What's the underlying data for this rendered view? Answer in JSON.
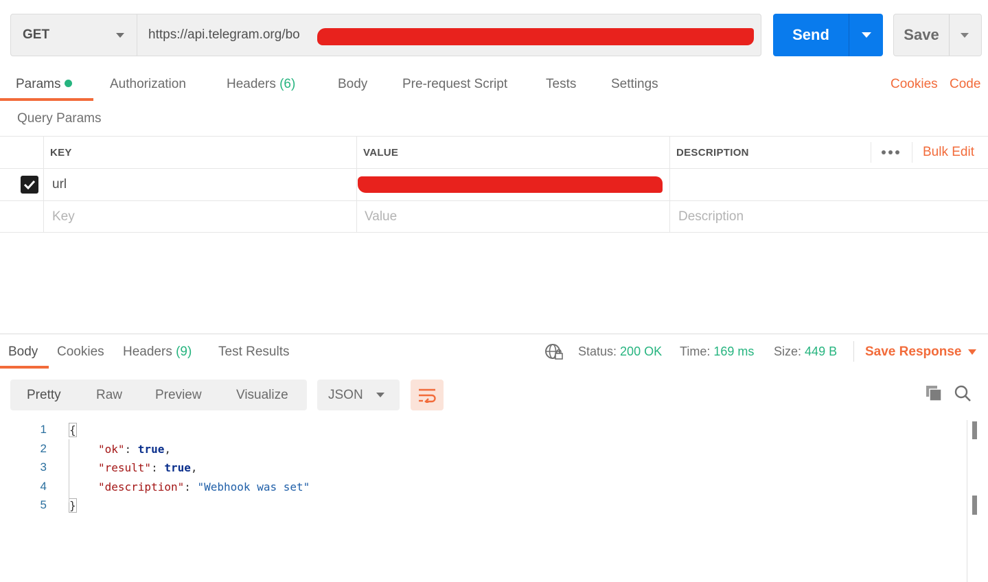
{
  "request": {
    "method": "GET",
    "url": "https://api.telegram.org/bo",
    "send_label": "Send",
    "save_label": "Save"
  },
  "request_tabs": {
    "params": "Params",
    "authorization": "Authorization",
    "headers": "Headers",
    "headers_count": "(6)",
    "body": "Body",
    "prerequest": "Pre-request Script",
    "tests": "Tests",
    "settings": "Settings",
    "cookies": "Cookies",
    "code": "Code"
  },
  "query_params": {
    "title": "Query Params",
    "headers": {
      "key": "KEY",
      "value": "VALUE",
      "description": "DESCRIPTION",
      "bulk_edit": "Bulk Edit"
    },
    "rows": [
      {
        "checked": true,
        "key": "url",
        "value": "",
        "description": ""
      }
    ],
    "placeholders": {
      "key": "Key",
      "value": "Value",
      "description": "Description"
    }
  },
  "response": {
    "tabs": {
      "body": "Body",
      "cookies": "Cookies",
      "headers": "Headers",
      "headers_count": "(9)",
      "test_results": "Test Results"
    },
    "status_label": "Status:",
    "status_value": "200 OK",
    "time_label": "Time:",
    "time_value": "169 ms",
    "size_label": "Size:",
    "size_value": "449 B",
    "save_response": "Save Response",
    "view_modes": {
      "pretty": "Pretty",
      "raw": "Raw",
      "preview": "Preview",
      "visualize": "Visualize"
    },
    "format": "JSON",
    "code_lines": [
      {
        "n": "1",
        "open": "{"
      },
      {
        "n": "2",
        "key": "\"ok\"",
        "sep": ": ",
        "val": "true",
        "end": ","
      },
      {
        "n": "3",
        "key": "\"result\"",
        "sep": ": ",
        "val": "true",
        "end": ","
      },
      {
        "n": "4",
        "key": "\"description\"",
        "sep": ": ",
        "str": "\"Webhook was set\""
      },
      {
        "n": "5",
        "close": "}"
      }
    ]
  },
  "colors": {
    "accent": "#f26b3a",
    "send": "#097bed",
    "success": "#26b47f",
    "redaction": "#e8221d"
  }
}
